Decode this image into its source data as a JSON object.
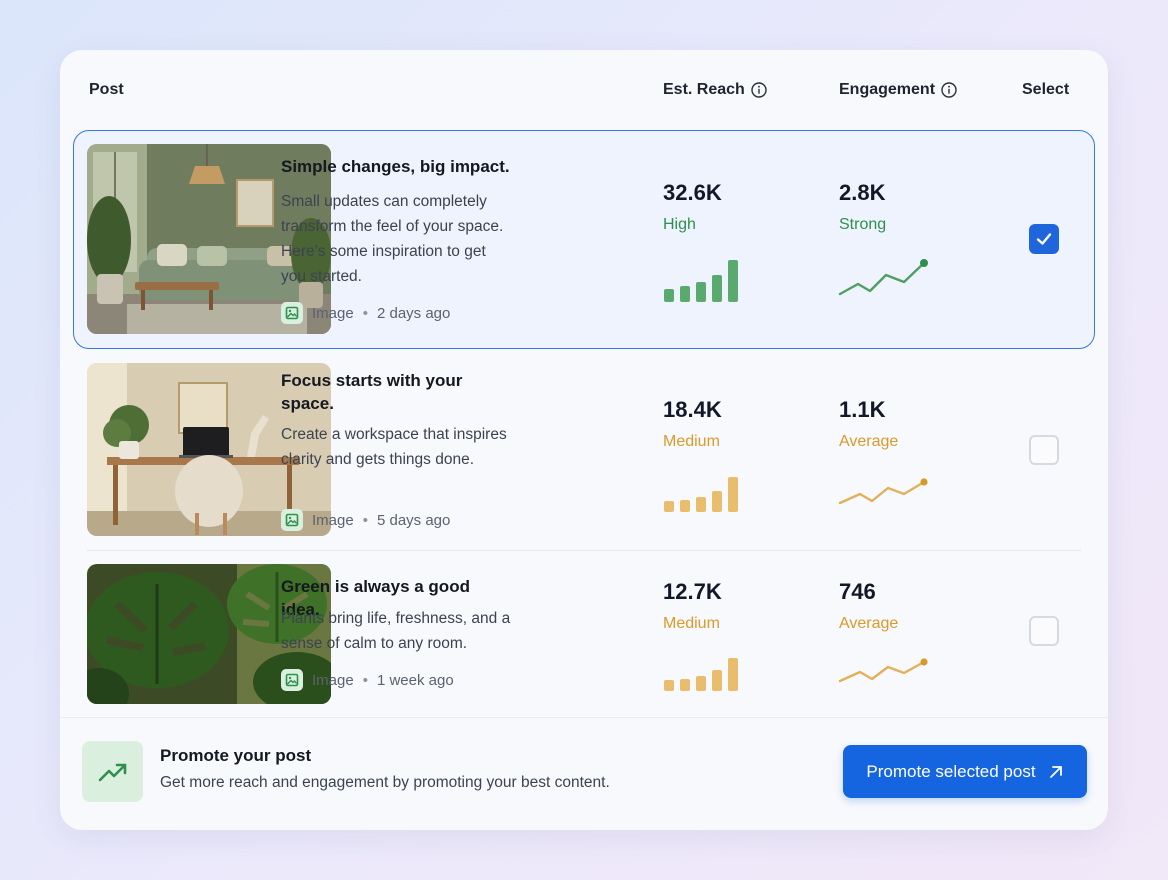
{
  "header": {
    "post": "Post",
    "reach": "Est. Reach",
    "engagement": "Engagement",
    "select": "Select"
  },
  "rows": [
    {
      "title": "Simple changes, big impact.",
      "description": "Small updates can completely transform the feel of your space. Here’s some inspiration to get you started.",
      "type": "Image",
      "time": "2 days ago",
      "reach": "32.6K",
      "reach_level": "High",
      "engagement": "2.8K",
      "engagement_level": "Strong",
      "selected": true,
      "thumbnail": "living-room"
    },
    {
      "title": "Focus starts with your space.",
      "description": "Create a workspace that inspires clarity and gets things done.",
      "type": "Image",
      "time": "5 days ago",
      "reach": "18.4K",
      "reach_level": "Medium",
      "engagement": "1.1K",
      "engagement_level": "Average",
      "selected": false,
      "thumbnail": "workspace"
    },
    {
      "title": "Green is always a good idea.",
      "description": "Plants bring life, freshness, and a sense of calm to any room.",
      "type": "Image",
      "time": "1 week ago",
      "reach": "12.7K",
      "reach_level": "Medium",
      "engagement": "746",
      "engagement_level": "Average",
      "selected": false,
      "thumbnail": "monstera"
    }
  ],
  "promo": {
    "title": "Promote your post",
    "description": "Get more reach and engagement by promoting your best content.",
    "button": "Promote selected post"
  },
  "colors": {
    "accent": "#1565e0",
    "strong": "#2f8f4e",
    "average": "#d99a2b",
    "selected_border": "#3677e0"
  },
  "icons": [
    "info-icon",
    "image-icon",
    "checkmark-icon",
    "trending-up-icon",
    "arrow-up-right-icon"
  ]
}
